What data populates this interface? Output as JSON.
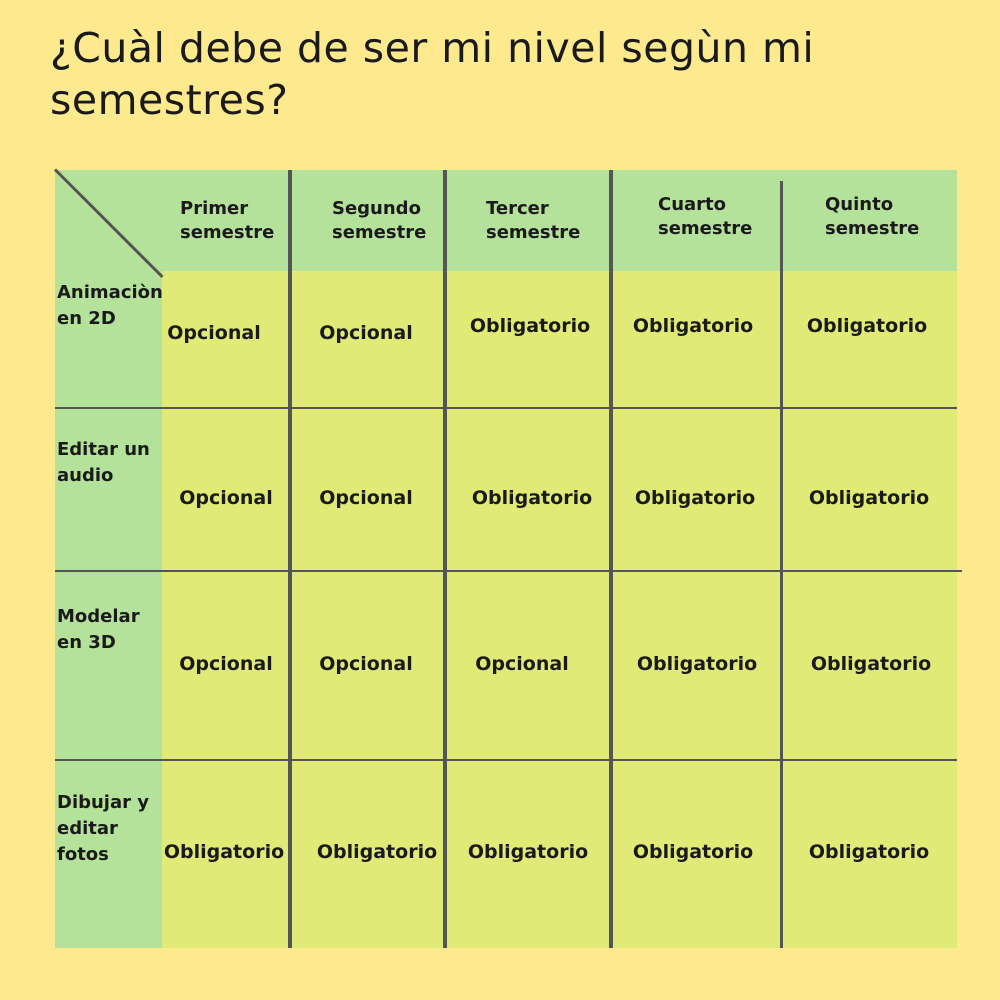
{
  "title": "¿Cuàl debe de ser mi nivel segùn mi semestres?",
  "table": {
    "columns": [
      "Primer semestre",
      "Segundo semestre",
      "Tercer semestre",
      "Cuarto semestre",
      "Quinto semestre"
    ],
    "rows": [
      {
        "label": "Animaciòn en 2D",
        "cells": [
          "Opcional",
          "Opcional",
          "Obligatorio",
          "Obligatorio",
          "Obligatorio"
        ]
      },
      {
        "label": "Editar un audio",
        "cells": [
          "Opcional",
          "Opcional",
          "Obligatorio",
          "Obligatorio",
          "Obligatorio"
        ]
      },
      {
        "label": "Modelar en 3D",
        "cells": [
          "Opcional",
          "Opcional",
          "Opcional",
          "Obligatorio",
          "Obligatorio"
        ]
      },
      {
        "label": "Dibujar y editar fotos",
        "cells": [
          "Obligatorio",
          "Obligatorio",
          "Obligatorio",
          "Obligatorio",
          "Obligatorio"
        ]
      }
    ]
  },
  "colors": {
    "background": "#fdea8f",
    "header_green": "#b5e29a",
    "cell_yellow_green": "#e0ea76",
    "grid_line": "#555555"
  }
}
